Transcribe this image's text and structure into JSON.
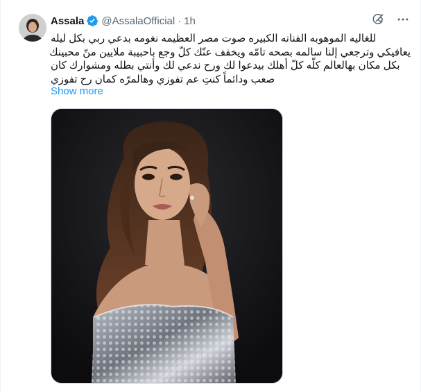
{
  "author": {
    "display_name": "Assala",
    "handle": "@AssalaOfficial",
    "separator": "·",
    "time": "1h",
    "verified": true
  },
  "icons": {
    "verified": "verified-badge-icon",
    "grok": "grok-icon",
    "more": "more-options-icon"
  },
  "tweet": {
    "lines": [
      "للغاليه الموهوبه الفنانه الكبيره صوت مصر العظيمه نغومه بدعي ربي بكل ليله",
      "يعافيكي وترجعي إلنا سالمه بصحه تامّه ويخفف عنّك كلّ وجع باحبيبة ملايين منّ محبينك",
      "بكل مكان بهالعالم كلّه كلّ أهلك بيدعوا لك ورح ندعي لك وأنتي بطله ومشوارك كان",
      "صعب ودائماً كنتِ عم تفوزي وهالمرّه كمان رح تفوزي"
    ],
    "show_more": "Show more"
  },
  "colors": {
    "link": "#1d9bf0",
    "secondary_text": "#536471",
    "primary_text": "#0f1419",
    "verified_badge": "#1d9bf0"
  }
}
